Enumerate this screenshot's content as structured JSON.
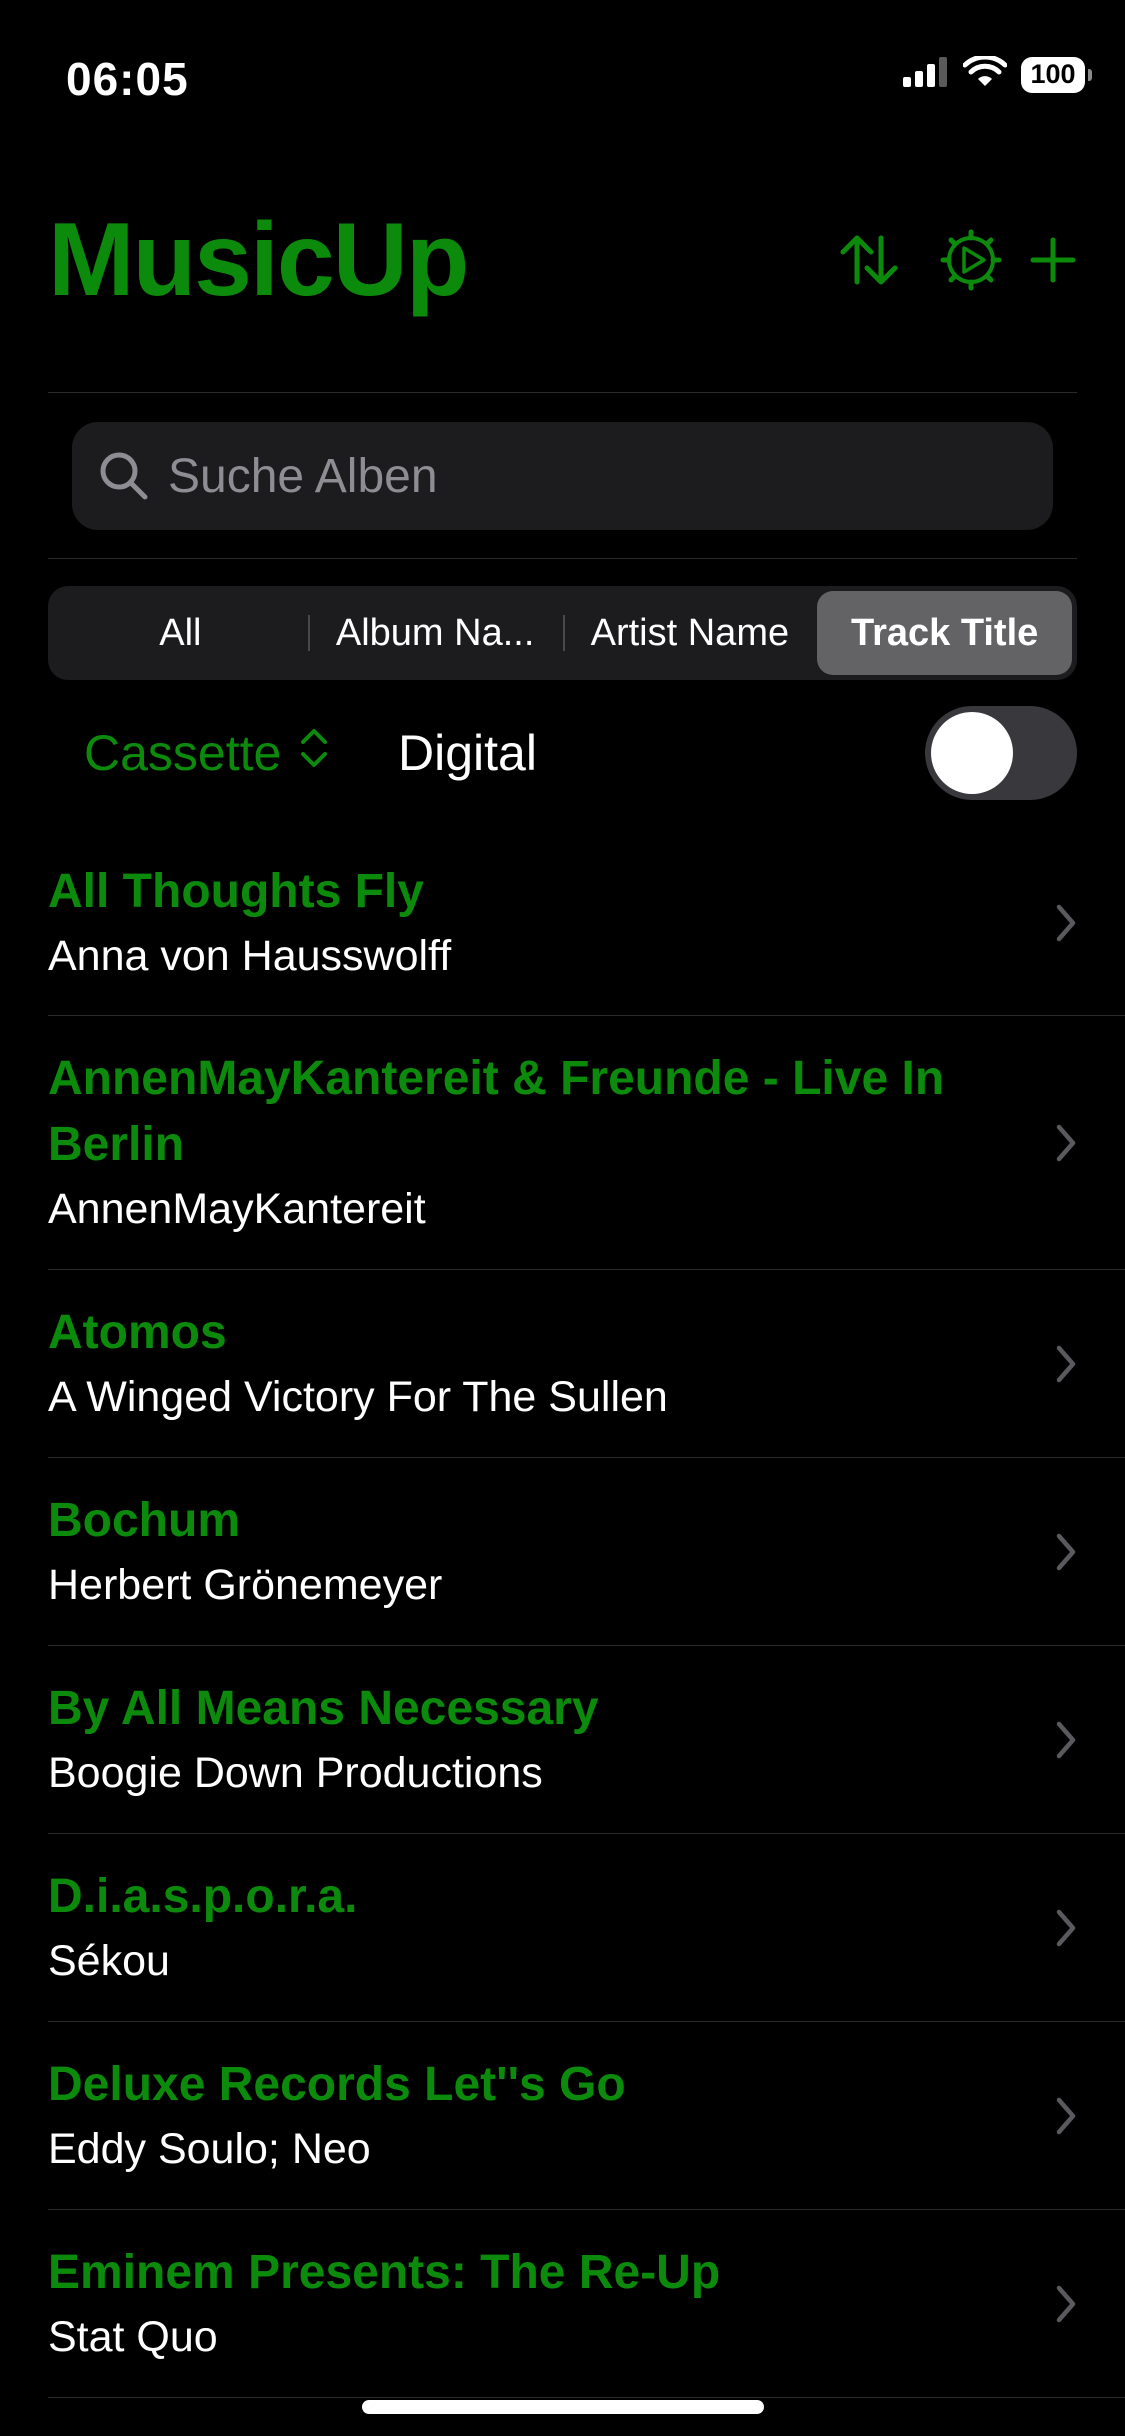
{
  "status_bar": {
    "time": "06:05",
    "battery": "100"
  },
  "header": {
    "title": "MusicUp",
    "accent_color": "#0c8a0c",
    "icons": [
      "sort-icon",
      "settings-icon",
      "add-icon"
    ]
  },
  "search": {
    "placeholder": "Suche Alben",
    "value": ""
  },
  "segments": {
    "all": "All",
    "album": "Album Na...",
    "artist": "Artist Name",
    "track": "Track Title",
    "selected": "Track Title"
  },
  "filter": {
    "picker_value": "Cassette",
    "toggle_label": "Digital",
    "toggle_on": false
  },
  "albums": [
    {
      "title": "All Thoughts Fly",
      "artist": "Anna von Hausswolff"
    },
    {
      "title": "AnnenMayKantereit & Freunde - Live In Berlin",
      "artist": "AnnenMayKantereit"
    },
    {
      "title": "Atomos",
      "artist": "A Winged Victory For The Sullen"
    },
    {
      "title": "Bochum",
      "artist": "Herbert Grönemeyer"
    },
    {
      "title": "By All Means Necessary",
      "artist": "Boogie Down Productions"
    },
    {
      "title": "D.i.a.s.p.o.r.a.",
      "artist": "Sékou"
    },
    {
      "title": "Deluxe Records Let''s Go",
      "artist": "Eddy Soulo; Neo"
    },
    {
      "title": "Eminem Presents: The Re-Up",
      "artist": "Stat Quo"
    }
  ]
}
